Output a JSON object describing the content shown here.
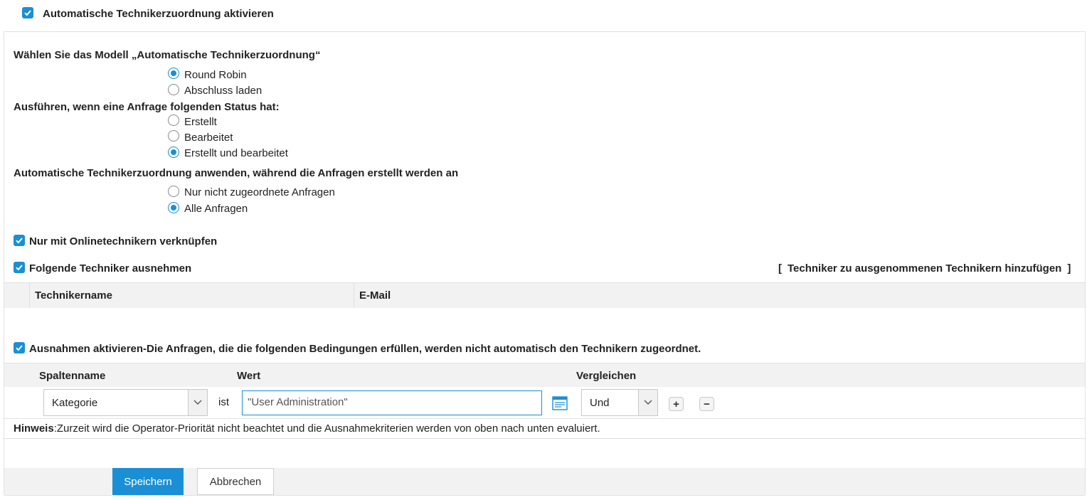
{
  "header": {
    "enable_label": "Automatische Technikerzuordnung aktivieren"
  },
  "model": {
    "title": "Wählen Sie das Modell „Automatische Technikerzuordnung“",
    "options": [
      "Round Robin",
      "Abschluss laden"
    ],
    "selected": "Round Robin"
  },
  "status": {
    "title": "Ausführen, wenn eine Anfrage folgenden Status hat:",
    "options": [
      "Erstellt",
      "Bearbeitet",
      "Erstellt und bearbeitet"
    ],
    "selected": "Erstellt und bearbeitet"
  },
  "apply": {
    "title": "Automatische Technikerzuordnung anwenden, während die Anfragen erstellt werden an",
    "options": [
      "Nur nicht zugeordnete Anfragen",
      "Alle Anfragen"
    ],
    "selected": "Alle Anfragen"
  },
  "online_only": {
    "label": "Nur mit Onlinetechnikern verknüpfen",
    "checked": true
  },
  "exclude": {
    "label": "Folgende Techniker ausnehmen",
    "checked": true,
    "add_link_open": "[",
    "add_link": "Techniker zu ausgenommenen Technikern hinzufügen",
    "add_link_close": "]",
    "columns": [
      "Technikername",
      "E-Mail"
    ]
  },
  "exceptions": {
    "label": "Ausnahmen aktivieren-Die Anfragen, die die folgenden Bedingungen erfüllen, werden nicht automatisch den Technikern zugeordnet.",
    "checked": true,
    "columns": {
      "name": "Spaltenname",
      "value": "Wert",
      "compare": "Vergleichen"
    },
    "row": {
      "column": "Kategorie",
      "operator": "ist",
      "value": "\"User Administration\"",
      "compare": "Und"
    }
  },
  "note": {
    "label": "Hinweis",
    "text": ":Zurzeit wird die Operator-Priorität nicht beachtet und die Ausnahmekriterien werden von oben nach unten evaluiert."
  },
  "actions": {
    "save": "Speichern",
    "cancel": "Abbrechen"
  },
  "colors": {
    "accent": "#1a8fd6",
    "table_header_bg": "#f2f2f2",
    "footer_bg": "#f2f2f2"
  }
}
